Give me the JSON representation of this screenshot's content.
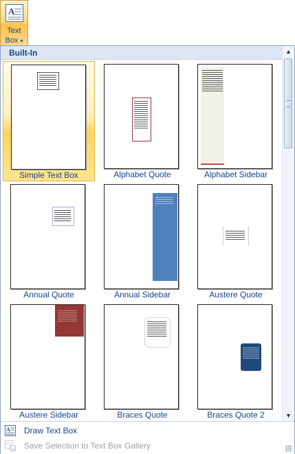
{
  "ribbon": {
    "label_line1": "Text",
    "label_line2": "Box",
    "dropdown_arrow": "▾"
  },
  "gallery": {
    "section_header": "Built-In",
    "items": [
      {
        "label": "Simple Text Box",
        "selected": true
      },
      {
        "label": "Alphabet Quote",
        "selected": false
      },
      {
        "label": "Alphabet Sidebar",
        "selected": false
      },
      {
        "label": "Annual Quote",
        "selected": false
      },
      {
        "label": "Annual Sidebar",
        "selected": false
      },
      {
        "label": "Austere Quote",
        "selected": false
      },
      {
        "label": "Austere Sidebar",
        "selected": false
      },
      {
        "label": "Braces Quote",
        "selected": false
      },
      {
        "label": "Braces Quote 2",
        "selected": false
      }
    ]
  },
  "scrollbar": {
    "up_arrow": "▲",
    "down_arrow": "▼"
  },
  "menu": {
    "draw_text_box": "Draw Text Box",
    "save_selection": "Save Selection to Text Box Gallery",
    "save_selection_disabled": true
  },
  "colors": {
    "accent_blue": "#15428b",
    "annual_sidebar": "#4f81bd",
    "austere_sidebar": "#953734",
    "braces_quote2": "#1f497d",
    "alphabet_sidebar_bg": "#f2f1e8",
    "selection_gold": "#ffd45c"
  }
}
